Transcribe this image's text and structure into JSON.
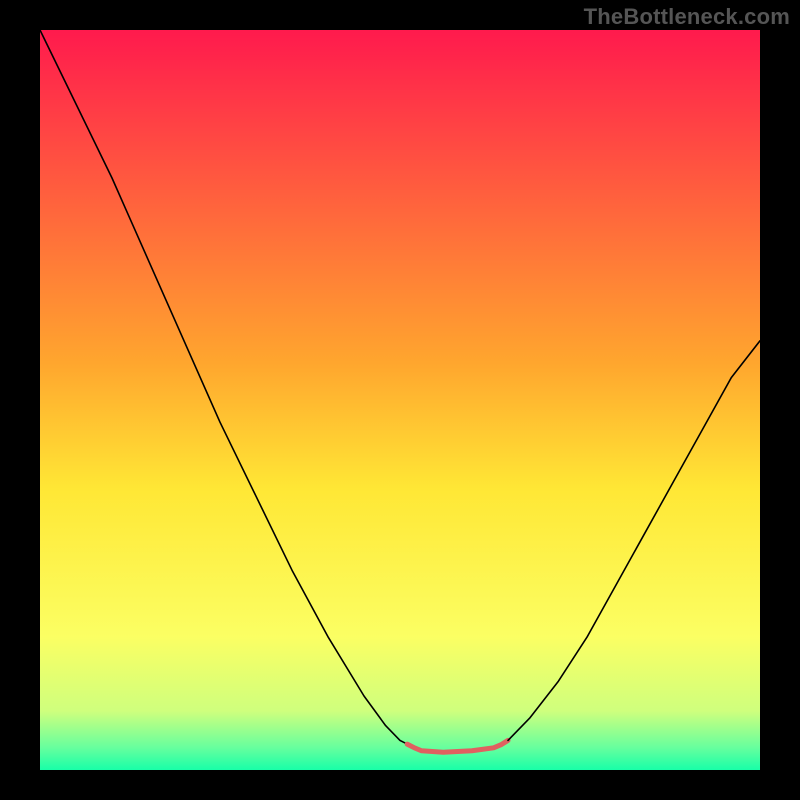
{
  "watermark": "TheBottleneck.com",
  "chart_data": {
    "type": "line",
    "title": "",
    "xlabel": "",
    "ylabel": "",
    "xlim": [
      0,
      100
    ],
    "ylim": [
      0,
      100
    ],
    "grid": false,
    "legend": false,
    "background_gradient_stops": [
      {
        "offset": 0,
        "color": "#ff1a4d"
      },
      {
        "offset": 45,
        "color": "#ffa62e"
      },
      {
        "offset": 62,
        "color": "#ffe735"
      },
      {
        "offset": 82,
        "color": "#fbff63"
      },
      {
        "offset": 92,
        "color": "#cfff7d"
      },
      {
        "offset": 97,
        "color": "#66ff9e"
      },
      {
        "offset": 100,
        "color": "#18ffa8"
      }
    ],
    "series": [
      {
        "name": "left-curve",
        "stroke": "#000000",
        "stroke_width": 1.6,
        "x": [
          0,
          5,
          10,
          15,
          20,
          25,
          30,
          35,
          40,
          45,
          48,
          50,
          51
        ],
        "y": [
          100,
          90,
          80,
          69,
          58,
          47,
          37,
          27,
          18,
          10,
          6,
          4,
          3.5
        ]
      },
      {
        "name": "flat-bottom-marker",
        "stroke": "#e06060",
        "stroke_width": 5,
        "x": [
          51,
          52,
          53,
          56,
          60,
          63,
          64,
          65
        ],
        "y": [
          3.5,
          3,
          2.6,
          2.4,
          2.6,
          3,
          3.4,
          4
        ]
      },
      {
        "name": "right-curve",
        "stroke": "#000000",
        "stroke_width": 1.6,
        "x": [
          65,
          68,
          72,
          76,
          80,
          84,
          88,
          92,
          96,
          100
        ],
        "y": [
          4,
          7,
          12,
          18,
          25,
          32,
          39,
          46,
          53,
          58
        ]
      }
    ]
  }
}
